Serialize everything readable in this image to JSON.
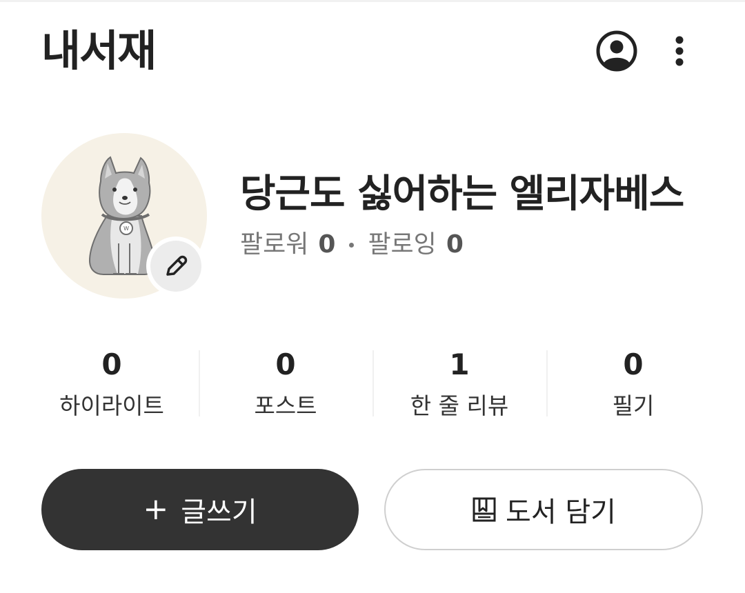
{
  "header": {
    "title": "내서재"
  },
  "profile": {
    "nickname": "당근도 싫어하는 엘리자베스",
    "followers_label": "팔로워",
    "followers_count": "0",
    "following_label": "팔로잉",
    "following_count": "0"
  },
  "stats": [
    {
      "count": "0",
      "label": "하이라이트"
    },
    {
      "count": "0",
      "label": "포스트"
    },
    {
      "count": "1",
      "label": "한 줄 리뷰"
    },
    {
      "count": "0",
      "label": "필기"
    }
  ],
  "actions": {
    "write_plus": "+",
    "write_label": "글쓰기",
    "shelf_label": "도서 담기"
  },
  "icons": {
    "profile": "account-circle-icon",
    "more": "more-vertical-icon",
    "edit": "pencil-icon",
    "shelf": "book-add-icon"
  },
  "colors": {
    "primary_dark": "#333333",
    "avatar_bg": "#f6f1e6",
    "muted_text": "#777777"
  }
}
